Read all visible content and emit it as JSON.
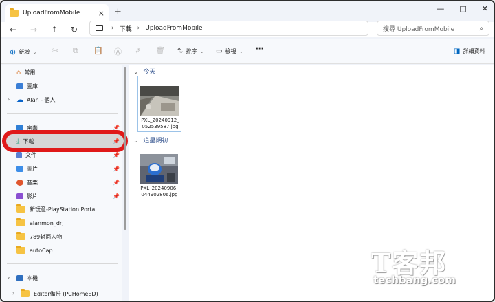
{
  "window": {
    "tab_title": "UploadFromMobile",
    "tab_close": "×",
    "new_tab": "+",
    "controls": {
      "minimize": "—",
      "maximize": "□",
      "close": "✕"
    }
  },
  "address": {
    "crumb1": "下載",
    "crumb2": "UploadFromMobile",
    "separator": "›",
    "search_placeholder": "搜尋 UploadFromMobile"
  },
  "toolbar": {
    "new_label": "新增",
    "sort_label": "排序",
    "view_label": "檢視",
    "more_label": "···",
    "details_label": "詳細資料"
  },
  "sidebar": {
    "top": [
      {
        "label": "常用",
        "icon": "home-icon"
      },
      {
        "label": "圖庫",
        "icon": "gallery-icon"
      },
      {
        "label": "Alan - 個人",
        "icon": "onedrive-icon"
      }
    ],
    "pinned": [
      {
        "label": "桌面",
        "icon": "desktop-icon",
        "color": "#2f7fd6"
      },
      {
        "label": "下載",
        "icon": "download-icon",
        "color": "#1f9b74"
      },
      {
        "label": "文件",
        "icon": "documents-icon",
        "color": "#5b7fd1"
      },
      {
        "label": "圖片",
        "icon": "pictures-icon",
        "color": "#3d8ee8"
      },
      {
        "label": "音樂",
        "icon": "music-icon",
        "color": "#e0562e"
      },
      {
        "label": "影片",
        "icon": "videos-icon",
        "color": "#8a4fd1"
      },
      {
        "label": "新玩意-PlayStation Portal",
        "icon": "folder-icon",
        "color": "#f6c343"
      },
      {
        "label": "alanmon_drj",
        "icon": "folder-icon",
        "color": "#f6c343"
      },
      {
        "label": "789封面人物",
        "icon": "folder-icon",
        "color": "#f6c343"
      },
      {
        "label": "autoCap",
        "icon": "folder-icon",
        "color": "#f6c343"
      }
    ],
    "pc": {
      "label": "本機",
      "icon": "pc-icon"
    },
    "drive": {
      "label": "Editor備份 (PCHomeED)",
      "icon": "folder-icon"
    },
    "pin_glyph": "📌"
  },
  "content": {
    "groups": [
      {
        "label": "今天",
        "file": {
          "name_line1": "PXL_20240912_",
          "name_line2": "052539587.jpg"
        }
      },
      {
        "label": "這星期初",
        "file": {
          "name_line1": "PXL_20240906_",
          "name_line2": "044902806.jpg"
        }
      }
    ]
  },
  "watermark": {
    "logo": "T客邦",
    "site": "techbang.com"
  },
  "colors": {
    "accent": "#0067c0",
    "highlight_ring": "#e01919",
    "selection": "#d6d6d6"
  }
}
